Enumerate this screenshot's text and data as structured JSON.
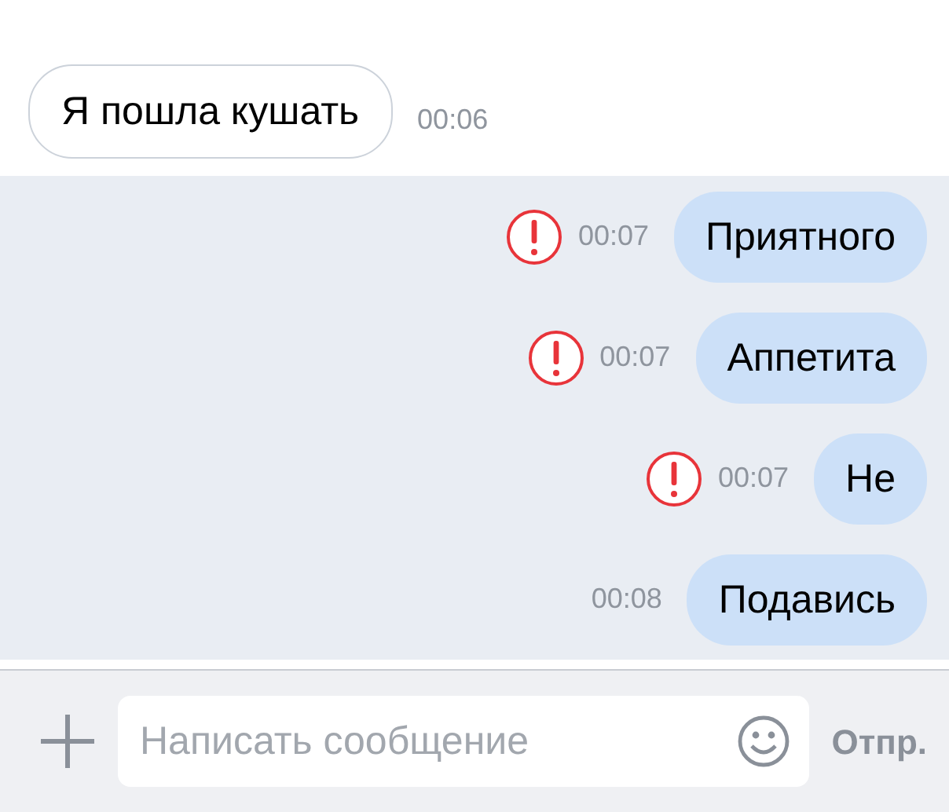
{
  "messages": [
    {
      "text": "Я пошла кушать",
      "time": "00:06",
      "outgoing": false,
      "failed": false,
      "unread": false
    },
    {
      "text": "Приятного",
      "time": "00:07",
      "outgoing": true,
      "failed": true,
      "unread": true
    },
    {
      "text": "Аппетита",
      "time": "00:07",
      "outgoing": true,
      "failed": true,
      "unread": true
    },
    {
      "text": "Не",
      "time": "00:07",
      "outgoing": true,
      "failed": true,
      "unread": true
    },
    {
      "text": "Подавись",
      "time": "00:08",
      "outgoing": true,
      "failed": false,
      "unread": true
    }
  ],
  "composer": {
    "placeholder": "Написать сообщение",
    "send": "Отпр."
  }
}
